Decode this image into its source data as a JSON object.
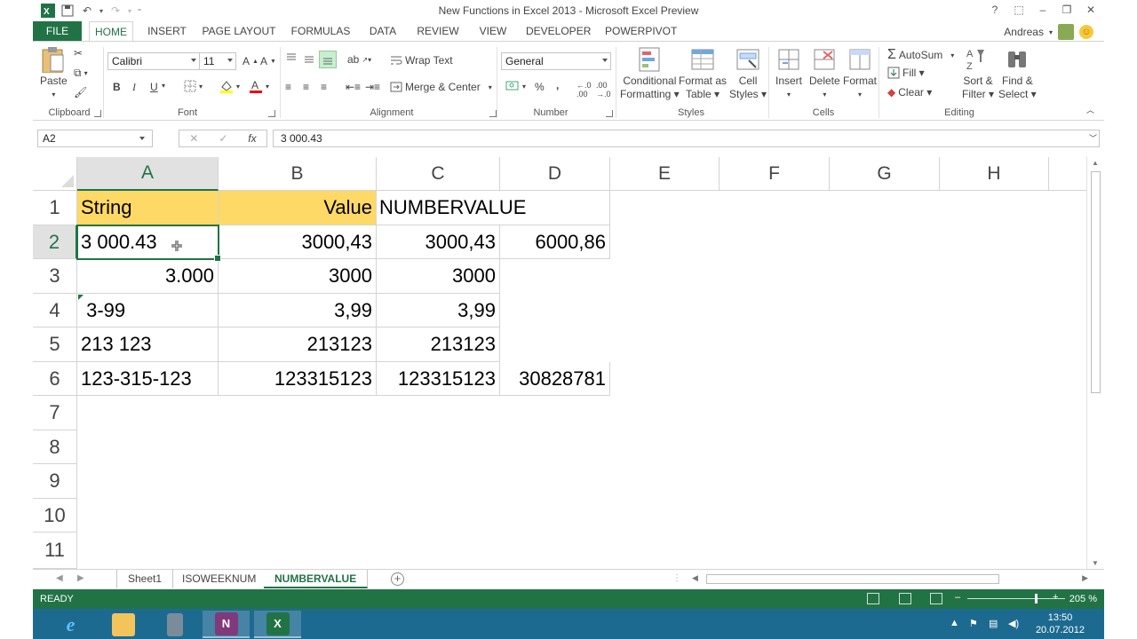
{
  "window": {
    "title": "New Functions in Excel 2013 - Microsoft Excel Preview",
    "controls": [
      "?",
      "⬚",
      "–",
      "❐",
      "✕"
    ]
  },
  "tabs": [
    {
      "label": "FILE"
    },
    {
      "label": "HOME"
    },
    {
      "label": "INSERT"
    },
    {
      "label": "PAGE LAYOUT"
    },
    {
      "label": "FORMULAS"
    },
    {
      "label": "DATA"
    },
    {
      "label": "REVIEW"
    },
    {
      "label": "VIEW"
    },
    {
      "label": "DEVELOPER"
    },
    {
      "label": "POWERPIVOT"
    }
  ],
  "user": {
    "name": "Andreas"
  },
  "ribbon": {
    "clipboard": {
      "label": "Clipboard",
      "paste": "Paste"
    },
    "font": {
      "label": "Font",
      "name": "Calibri",
      "size": "11",
      "bold": "B",
      "italic": "I",
      "underline": "U"
    },
    "alignment": {
      "label": "Alignment",
      "wrap": "Wrap Text",
      "merge": "Merge & Center"
    },
    "number": {
      "label": "Number",
      "format": "General",
      "percent": "%",
      "comma": ","
    },
    "styles": {
      "label": "Styles",
      "conditional": [
        "Conditional",
        "Formatting ▾"
      ],
      "format_table": [
        "Format as",
        "Table ▾"
      ],
      "cell_styles": [
        "Cell",
        "Styles ▾"
      ]
    },
    "cells": {
      "label": "Cells",
      "insert": "Insert",
      "delete": "Delete",
      "format": "Format"
    },
    "editing": {
      "label": "Editing",
      "autosum": "AutoSum",
      "fill": "Fill ▾",
      "clear": "Clear ▾",
      "sort": [
        "Sort &",
        "Filter ▾"
      ],
      "find": [
        "Find &",
        "Select ▾"
      ]
    }
  },
  "formula_bar": {
    "name_box": "A2",
    "formula": "3 000.43"
  },
  "columns": [
    "A",
    "B",
    "C",
    "D",
    "E",
    "F",
    "G",
    "H"
  ],
  "rows": [
    "1",
    "2",
    "3",
    "4",
    "5",
    "6",
    "7",
    "8",
    "9",
    "10",
    "11"
  ],
  "cells": {
    "A1": "String",
    "B1": "Value",
    "C1": "NUMBERVALUE",
    "A2": "3 000.43",
    "B2": "3000,43",
    "C2": "3000,43",
    "D2": "6000,86",
    "A3": "3.000",
    "B3": "3000",
    "C3": "3000",
    "A4": " 3-99",
    "B4": "3,99",
    "C4": "3,99",
    "A5": "213 123",
    "B5": "213123",
    "C5": "213123",
    "A6": "123-315-123",
    "B6": "123315123",
    "C6": "123315123",
    "D6": "30828781"
  },
  "sheets": [
    {
      "label": "Sheet1"
    },
    {
      "label": "ISOWEEKNUM"
    },
    {
      "label": "NUMBERVALUE"
    }
  ],
  "status": {
    "ready": "READY",
    "zoom": "205 %"
  },
  "taskbar": {
    "time": "13:50",
    "date": "20.07.2012"
  },
  "colors": {
    "excel_green": "#217346",
    "header_yellow": "#ffd966",
    "taskbar": "#1d6a90"
  }
}
